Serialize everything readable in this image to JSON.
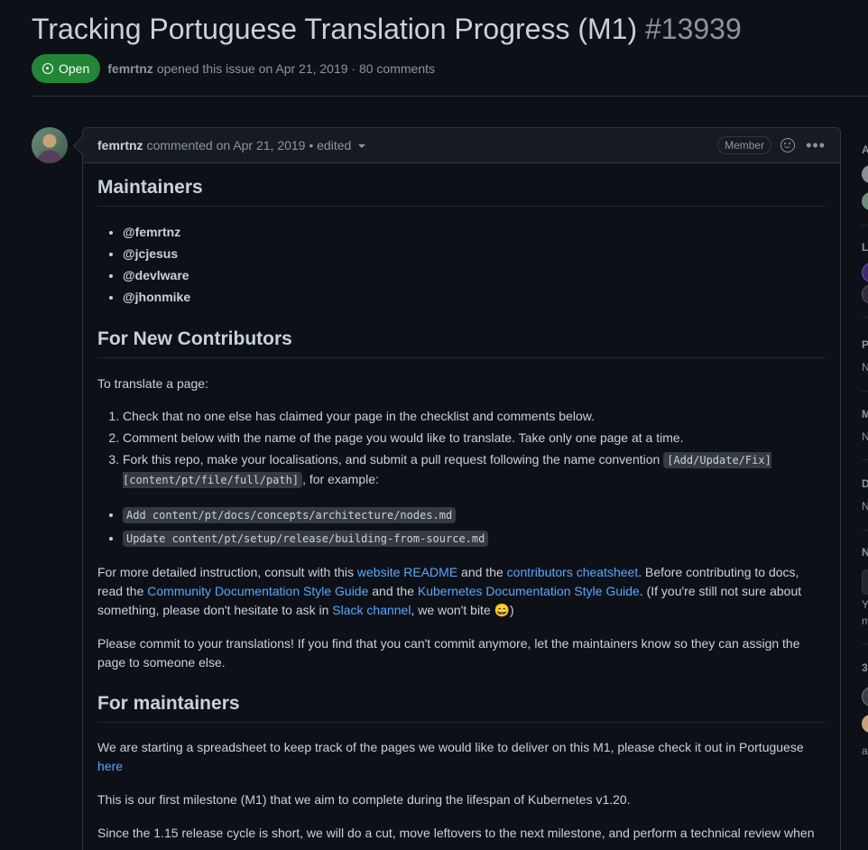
{
  "issue": {
    "title": "Tracking Portuguese Translation Progress (M1)",
    "number": "#13939",
    "state": "Open",
    "author": "femrtnz",
    "meta_rest": "opened this issue on Apr 21, 2019 · 80 comments"
  },
  "comment": {
    "author": "femrtnz",
    "meta": "commented on Apr 21, 2019 • edited",
    "role": "Member",
    "sections": {
      "maintainers_heading": "Maintainers",
      "maintainers": [
        "@femrtnz",
        "@jcjesus",
        "@devlware",
        "@jhonmike"
      ],
      "new_contrib_heading": "For New Contributors",
      "intro": "To translate a page:",
      "steps": [
        "Check that no one else has claimed your page in the checklist and comments below.",
        "Comment below with the name of the page you would like to translate. Take only one page at a time.",
        "Fork this repo, make your localisations, and submit a pull request following the name convention"
      ],
      "step3_code": "[Add/Update/Fix] [content/pt/file/full/path]",
      "step3_suffix": ", for example:",
      "examples": [
        "Add content/pt/docs/concepts/architecture/nodes.md",
        "Update content/pt/setup/release/building-from-source.md"
      ],
      "detail": {
        "t1": "For more detailed instruction, consult with this ",
        "l1": "website README",
        "t2": " and the ",
        "l2": "contributors cheatsheet",
        "t3": ". Before contributing to docs, read the ",
        "l3": "Community Documentation Style Guide",
        "t4": " and the ",
        "l4": "Kubernetes Documentation Style Guide",
        "t5": ". (If you're still not sure about something, please don't hesitate to ask in ",
        "l5": "Slack channel",
        "t6": ", we won't bite 😄)"
      },
      "commit_text": "Please commit to your translations! If you find that you can't commit anymore, let the maintainers know so they can assign the page to someone else.",
      "maint_heading": "For maintainers",
      "spreadsheet_text": "We are starting a spreadsheet to keep track of the pages we would like to deliver on this M1, please check it out in Portuguese ",
      "spreadsheet_link": "here",
      "milestone_text": "This is our first milestone (M1) that we aim to complete during the lifespan of Kubernetes v1.20.",
      "release_text": "Since the 1.15 release cycle is short, we will do a cut, move leftovers to the next milestone, and perform a technical review when"
    }
  },
  "sidebar": {
    "h1": "A",
    "h2": "L",
    "h3": "P",
    "t3": "N",
    "h4": "M",
    "t4": "N",
    "h5": "D",
    "t5": "N",
    "h6": "N",
    "t6a": "Y",
    "t6b": "m",
    "h7": "3",
    "t7": "a"
  },
  "colors": {
    "open_badge": "#238636",
    "link": "#58a6ff",
    "background": "#0d1117"
  }
}
